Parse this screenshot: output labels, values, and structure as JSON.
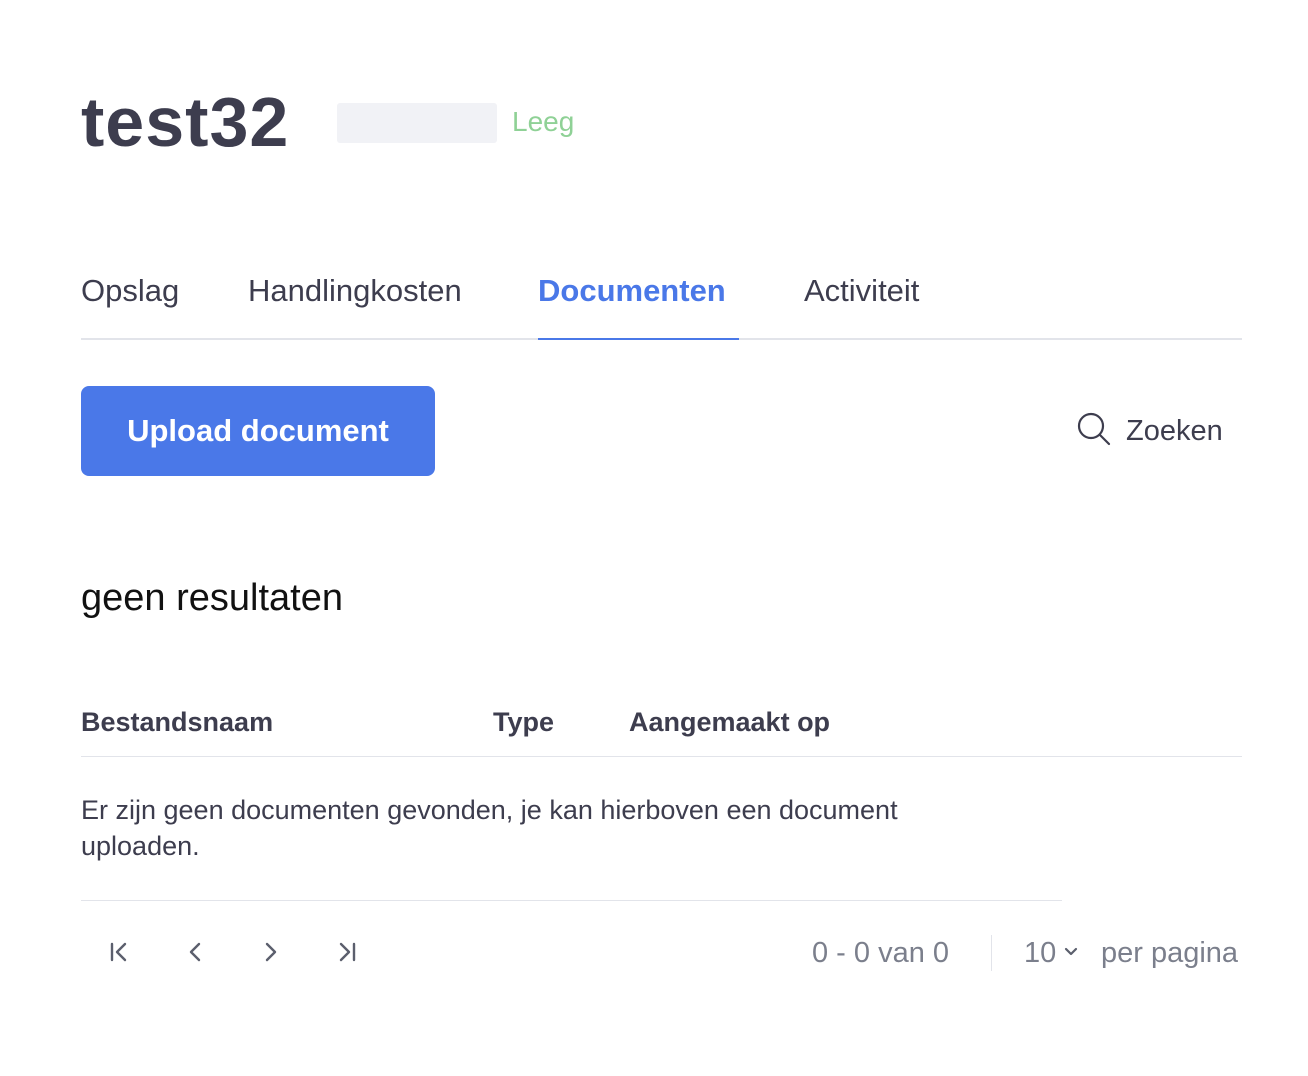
{
  "header": {
    "title": "test32",
    "status": "Leeg"
  },
  "tabs": [
    {
      "label": "Opslag",
      "active": false
    },
    {
      "label": "Handlingkosten",
      "active": false
    },
    {
      "label": "Documenten",
      "active": true
    },
    {
      "label": "Activiteit",
      "active": false
    }
  ],
  "toolbar": {
    "upload_label": "Upload document",
    "search_label": "Zoeken",
    "search_icon": "search-icon"
  },
  "results": {
    "heading": "geen resultaten",
    "columns": [
      "Bestandsnaam",
      "Type",
      "Aangemaakt op"
    ],
    "empty_message": "Er zijn geen documenten gevonden, je kan hierboven een document uploaden."
  },
  "pagination": {
    "range": "0 - 0 van 0",
    "per_page_value": "10",
    "per_page_label": "per pagina",
    "icons": [
      "first-page-icon",
      "previous-page-icon",
      "next-page-icon",
      "last-page-icon"
    ]
  },
  "colors": {
    "accent": "#4a78e8",
    "status": "#8fd196",
    "text": "#3d3d4e",
    "muted": "#7b7f8c",
    "divider": "#e2e4ea"
  }
}
